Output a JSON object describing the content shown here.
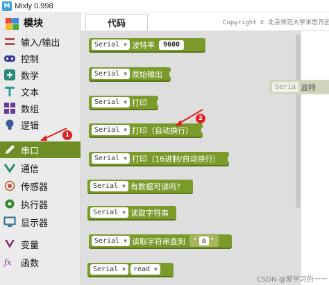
{
  "window": {
    "title": "Mixly 0.998",
    "app_icon_letter": "M"
  },
  "sidebar": {
    "title": "模块",
    "title_icon": "puzzle-icon",
    "items": [
      {
        "label": "输入/输出",
        "icon": "io-icon",
        "color": "#b05050"
      },
      {
        "label": "控制",
        "icon": "gamepad-icon",
        "color": "#3a3a9a"
      },
      {
        "label": "数学",
        "icon": "math-icon",
        "color": "#2a8a7a"
      },
      {
        "label": "文本",
        "icon": "text-icon",
        "color": "#2a9a9a"
      },
      {
        "label": "数组",
        "icon": "array-icon",
        "color": "#6a3a9a"
      },
      {
        "label": "逻辑",
        "icon": "bulb-icon",
        "color": "#3a5a9a"
      },
      {
        "label": "串口",
        "icon": "pen-icon",
        "color": "#ffffff",
        "active": true
      },
      {
        "label": "通信",
        "icon": "comm-icon",
        "color": "#2a8a6a"
      },
      {
        "label": "传感器",
        "icon": "sensor-icon",
        "color": "#c05030"
      },
      {
        "label": "执行器",
        "icon": "actuator-icon",
        "color": "#2a8a2a"
      },
      {
        "label": "显示器",
        "icon": "monitor-icon",
        "color": "#2a6a8a"
      },
      {
        "label": "变量",
        "icon": "variable-icon",
        "color": "#8a2a6a"
      },
      {
        "label": "函数",
        "icon": "function-icon",
        "color": "#6a2a9a"
      }
    ]
  },
  "tabs": [
    {
      "label": "代码"
    }
  ],
  "copyright": "Copyright © 北京师范大学米思齐团",
  "blocks": [
    {
      "port": "Serial",
      "text": "波特率",
      "value": "9600"
    },
    {
      "port": "Serial",
      "text": "原始输出"
    },
    {
      "port": "Serial",
      "text": "打印"
    },
    {
      "port": "Serial",
      "text": "打印（自动换行）"
    },
    {
      "port": "Serial",
      "text": "打印（16进制/自动换行）"
    },
    {
      "port": "Serial",
      "text": "有数据可读吗？"
    },
    {
      "port": "Serial",
      "text": "读取字符串"
    },
    {
      "port": "Serial",
      "text": "读取字符串直到",
      "string_value": "a"
    },
    {
      "port": "Serial",
      "text": "read"
    }
  ],
  "workspace_ghost_block": {
    "port": "Seria",
    "text": "波特"
  },
  "annotations": {
    "badge1": "1",
    "badge2": "2",
    "arrow_color": "#e02020"
  },
  "colors": {
    "block_green": "#7a9a2a",
    "active_category": "#6e8d24"
  },
  "watermark": "CSDN @爱学习的一一"
}
